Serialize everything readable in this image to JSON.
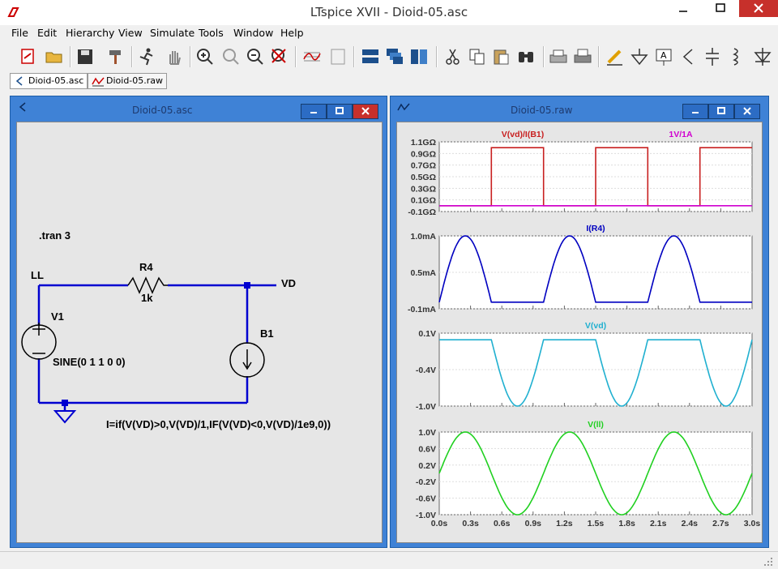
{
  "window": {
    "title": "LTspice XVII - Dioid-05.asc"
  },
  "menu": [
    "File",
    "Edit",
    "Hierarchy",
    "View",
    "Simulate",
    "Tools",
    "Window",
    "Help"
  ],
  "tabs": [
    {
      "label": "Dioid-05.asc",
      "icon": "schematic-icon"
    },
    {
      "label": "Dioid-05.raw",
      "icon": "waveform-icon"
    }
  ],
  "schematic": {
    "title": "Dioid-05.asc",
    "directive": ".tran 3",
    "net_ll": "LL",
    "net_vd": "VD",
    "r4_name": "R4",
    "r4_value": "1k",
    "v1_name": "V1",
    "v1_value": "SINE(0 1 1 0 0)",
    "b1_name": "B1",
    "b1_expr": "I=if(V(VD)>0,V(VD)/1,IF(V(VD)<0,V(VD)/1e9,0))"
  },
  "colors": {
    "trace1": "#c82020",
    "trace_ref": "#d000d0",
    "trace2": "#0000c0",
    "trace3": "#20b0d0",
    "trace4": "#20d020",
    "wire": "#0000d0"
  },
  "chart_data": [
    {
      "type": "line",
      "title": "V(vd)/I(B1)",
      "legend2": "1V/1A",
      "yticks": [
        "1.1GΩ",
        "0.9GΩ",
        "0.7GΩ",
        "0.5GΩ",
        "0.3GΩ",
        "0.1GΩ",
        "-0.1GΩ"
      ],
      "ylim": [
        -0.1,
        1.1
      ],
      "series": [
        {
          "name": "V(vd)/I(B1)",
          "color": "#c82020",
          "x": [
            0,
            0.5,
            0.5,
            1.0,
            1.0,
            1.5,
            1.5,
            2.0,
            2.0,
            2.5,
            2.5,
            3.0
          ],
          "y": [
            0,
            0,
            1,
            1,
            0,
            0,
            1,
            1,
            0,
            0,
            1,
            1
          ]
        },
        {
          "name": "1V/1A",
          "color": "#d000d0",
          "x": [
            0,
            3
          ],
          "y": [
            0,
            0
          ]
        }
      ]
    },
    {
      "type": "line",
      "title": "I(R4)",
      "yticks": [
        "1.0mA",
        "0.5mA",
        "-0.1mA"
      ],
      "ylim": [
        -0.1,
        1.0
      ],
      "series": [
        {
          "name": "I(R4)",
          "color": "#0000c0",
          "func": "posSine"
        }
      ]
    },
    {
      "type": "line",
      "title": "V(vd)",
      "yticks": [
        "0.1V",
        "-0.4V",
        "-1.0V"
      ],
      "ylim": [
        -1.0,
        0.1
      ],
      "series": [
        {
          "name": "V(vd)",
          "color": "#20b0d0",
          "func": "negSine"
        }
      ]
    },
    {
      "type": "line",
      "title": "V(ll)",
      "yticks": [
        "1.0V",
        "0.6V",
        "0.2V",
        "-0.2V",
        "-0.6V",
        "-1.0V"
      ],
      "ylim": [
        -1.0,
        1.0
      ],
      "series": [
        {
          "name": "V(ll)",
          "color": "#20d020",
          "func": "sine"
        }
      ]
    }
  ],
  "xaxis": {
    "ticks": [
      "0.0s",
      "0.3s",
      "0.6s",
      "0.9s",
      "1.2s",
      "1.5s",
      "1.8s",
      "2.1s",
      "2.4s",
      "2.7s",
      "3.0s"
    ],
    "xlim": [
      0,
      3
    ]
  }
}
